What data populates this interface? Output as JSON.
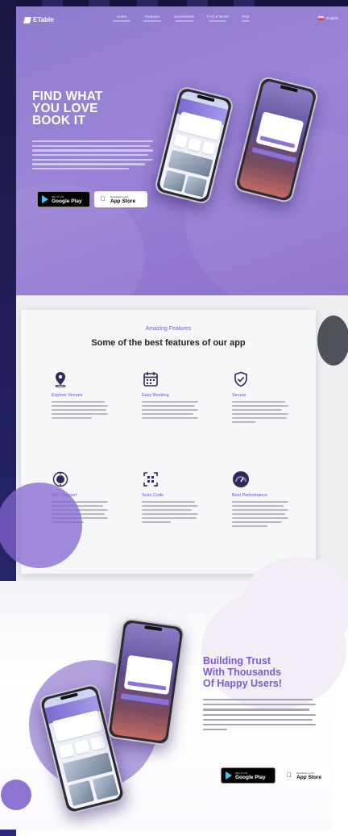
{
  "brand": {
    "name": "ETable"
  },
  "nav": {
    "items": [
      {
        "label": "Home"
      },
      {
        "label": "Features"
      },
      {
        "label": "Screenshots"
      },
      {
        "label": "FAQ & Terms"
      },
      {
        "label": "FAQ"
      }
    ],
    "language": "English"
  },
  "hero": {
    "title_lines": [
      "FIND WHAT",
      "YOU LOVE",
      "BOOK IT"
    ]
  },
  "stores": {
    "google": {
      "small": "GET IT ON",
      "big": "Google Play",
      "icon": "google-play-icon"
    },
    "apple": {
      "small": "Download on the",
      "big": "App Store",
      "icon": "apple-icon"
    }
  },
  "features": {
    "subtitle": "Amazing Features",
    "title": "Some of the best features of our app",
    "items": [
      {
        "name": "Explore Venues",
        "icon": "map-pin-icon"
      },
      {
        "name": "Easy Booking",
        "icon": "calendar-icon"
      },
      {
        "name": "Secure",
        "icon": "shield-check-icon"
      },
      {
        "name": "24/7 Support",
        "icon": "support-icon"
      },
      {
        "name": "Scan Code",
        "icon": "qr-scan-icon"
      },
      {
        "name": "Best Performance",
        "icon": "speedometer-icon"
      }
    ]
  },
  "trust": {
    "title_lines": [
      "Building Trust",
      "With Thousands",
      "Of Happy Users!"
    ]
  },
  "colors": {
    "hero_purple": "#9a84d6",
    "accent_purple": "#7c5ccd",
    "circle_purple": "#b3a1de"
  }
}
